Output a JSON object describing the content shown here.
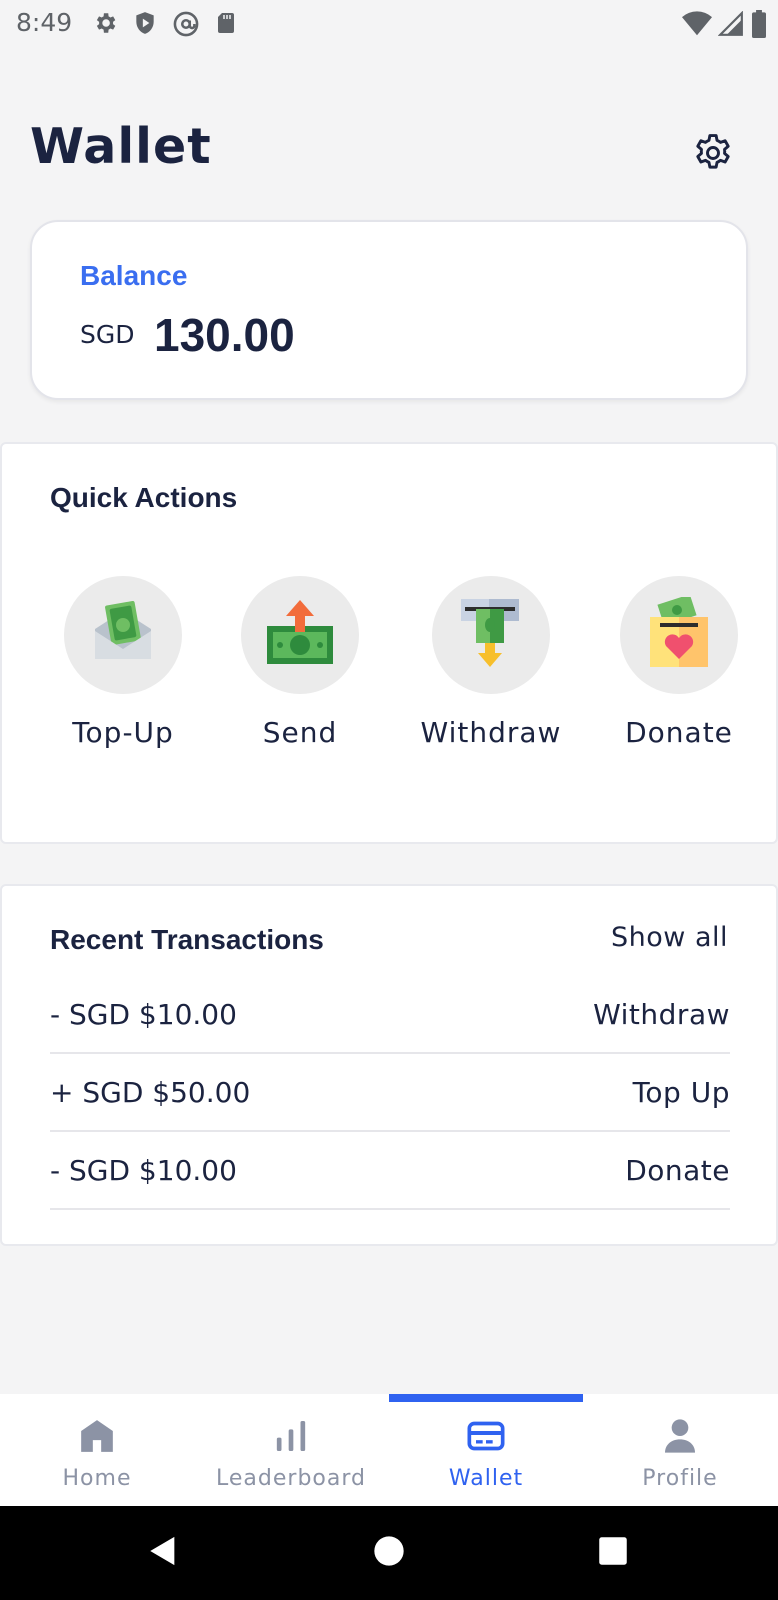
{
  "status_bar": {
    "time": "8:49",
    "left_icons": [
      "gear-icon",
      "shield-play-icon",
      "at-sign-icon",
      "sd-card-icon"
    ],
    "right_icons": [
      "wifi-icon",
      "cellular-signal-icon",
      "battery-icon"
    ]
  },
  "header": {
    "title": "Wallet",
    "settings_icon": "gear-icon"
  },
  "balance": {
    "label": "Balance",
    "currency": "SGD",
    "amount": "130.00",
    "accent_color": "#3a6ef0"
  },
  "quick_actions": {
    "title": "Quick Actions",
    "items": [
      {
        "label": "Top-Up",
        "icon": "cash-envelope-icon"
      },
      {
        "label": "Send",
        "icon": "cash-send-icon"
      },
      {
        "label": "Withdraw",
        "icon": "atm-withdraw-icon"
      },
      {
        "label": "Donate",
        "icon": "donation-box-icon"
      }
    ]
  },
  "recent_transactions": {
    "title": "Recent Transactions",
    "show_all": "Show all",
    "items": [
      {
        "amount": "- SGD $10.00",
        "type": "Withdraw"
      },
      {
        "amount": "+ SGD $50.00",
        "type": "Top Up"
      },
      {
        "amount": "- SGD $10.00",
        "type": "Donate"
      }
    ]
  },
  "bottom_nav": {
    "items": [
      {
        "label": "Home",
        "icon": "home-icon"
      },
      {
        "label": "Leaderboard",
        "icon": "bar-chart-icon"
      },
      {
        "label": "Wallet",
        "icon": "wallet-card-icon"
      },
      {
        "label": "Profile",
        "icon": "person-icon"
      }
    ],
    "active": "Wallet",
    "active_color": "#2f62f0",
    "inactive_color": "#8c93a5"
  },
  "system_nav": {
    "icons": [
      "back-icon",
      "home-circle-icon",
      "recents-square-icon"
    ]
  }
}
